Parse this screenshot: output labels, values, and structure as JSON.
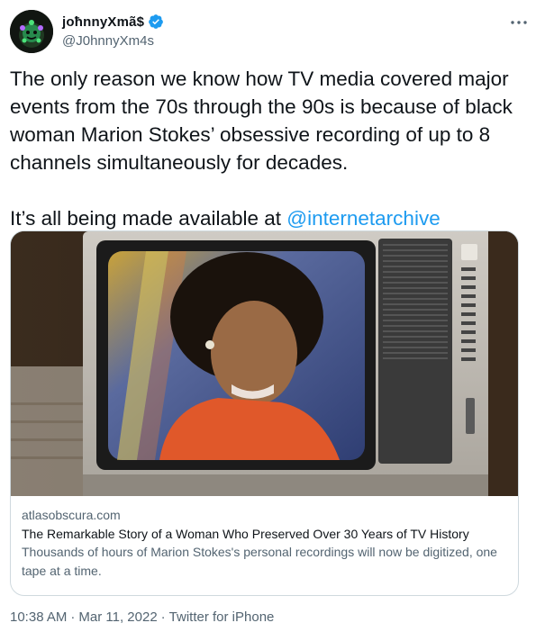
{
  "tweet": {
    "author": {
      "display_name": "jоħnnyXmã$",
      "handle": "@J0hnnyXm4s",
      "verified": true
    },
    "text_main": "The only reason we know how TV media covered major events from the 70s through the 90s is because of black woman Marion Stokes’ obsessive recording of up to 8 channels simultaneously for decades.",
    "text_line2_prefix": "It’s all being made available at ",
    "mention": "@internetarchive",
    "card": {
      "domain": "atlasobscura.com",
      "title": "The Remarkable Story of a Woman Who Preserved Over 30 Years of TV History",
      "description": "Thousands of hours of Marion Stokes's personal recordings will now be digitized, one tape at a time."
    },
    "meta": {
      "time": "10:38 AM",
      "date": "Mar 11, 2022",
      "separator": "·",
      "source": "Twitter for iPhone"
    }
  },
  "colors": {
    "accent": "#1d9bf0",
    "secondary_text": "#536471",
    "border": "#cfd9de"
  },
  "icons": {
    "verified": "verified-badge-icon",
    "more": "more-dots-icon"
  }
}
